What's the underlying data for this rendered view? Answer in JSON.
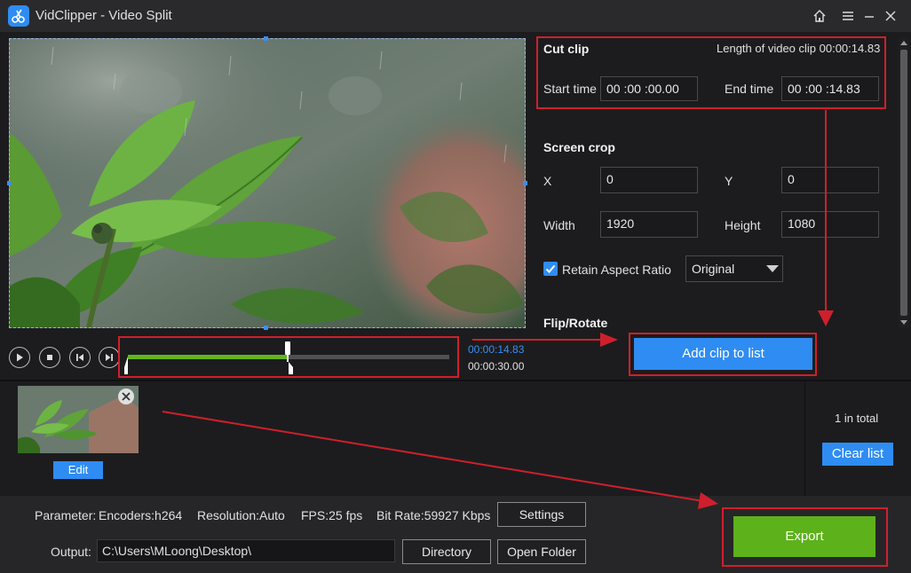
{
  "window": {
    "title": "VidClipper - Video Split",
    "icons": [
      "app-logo-icon",
      "home-icon",
      "menu-icon",
      "minimize-icon",
      "close-icon"
    ]
  },
  "cut_clip": {
    "title": "Cut clip",
    "length_label": "Length of video clip 00:00:14.83",
    "start_label": "Start time",
    "start_value": "00 :00 :00.00",
    "end_label": "End time",
    "end_value": "00 :00 :14.83"
  },
  "screen_crop": {
    "title": "Screen crop",
    "x_label": "X",
    "x_value": "0",
    "y_label": "Y",
    "y_value": "0",
    "width_label": "Width",
    "width_value": "1920",
    "height_label": "Height",
    "height_value": "1080",
    "retain_label": "Retain Aspect Ratio",
    "retain_checked": true,
    "ratio_value": "Original"
  },
  "flip_rotate": {
    "title": "Flip/Rotate"
  },
  "playback": {
    "current_time": "00:00:14.83",
    "total_time": "00:00:30.00",
    "progress_fraction": 0.494,
    "controls": [
      "play-icon",
      "stop-icon",
      "prev-frame-icon",
      "next-frame-icon"
    ]
  },
  "actions": {
    "add_clip_label": "Add clip to list"
  },
  "clip_list": {
    "edit_label": "Edit",
    "total_label": "1 in total",
    "clear_label": "Clear list"
  },
  "parameters": {
    "label": "Parameter:",
    "encoder": "Encoders:h264",
    "resolution": "Resolution:Auto",
    "fps": "FPS:25 fps",
    "bitrate": "Bit Rate:59927 Kbps",
    "settings_label": "Settings"
  },
  "output": {
    "label": "Output:",
    "path": "C:\\Users\\MLoong\\Desktop\\",
    "directory_label": "Directory",
    "open_folder_label": "Open Folder"
  },
  "export": {
    "label": "Export"
  },
  "colors": {
    "accent_blue": "#2f8cf2",
    "export_green": "#5db11b",
    "timeline_green": "#62b51d",
    "annotation_red": "#d01f2c",
    "background": "#1c1c1e"
  }
}
